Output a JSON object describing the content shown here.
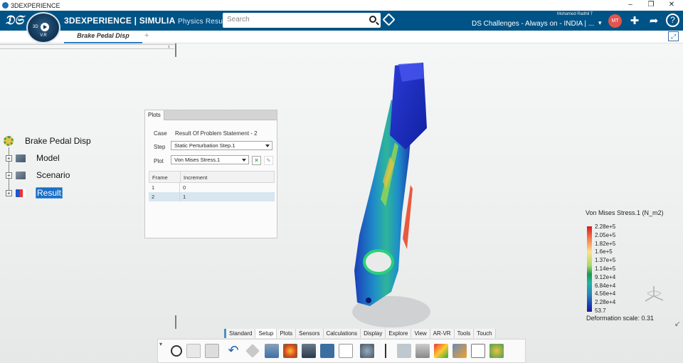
{
  "window": {
    "title": "3DEXPERIENCE",
    "controls": [
      "–",
      "❐",
      "✕"
    ]
  },
  "topbar": {
    "compass_version": "V.R",
    "compass_3d": "3D",
    "brand_prefix": "3D",
    "brand_main": "EXPERIENCE | SIMULIA",
    "brand_app": "Physics Results Explorer",
    "search_placeholder": "Search",
    "user_name": "Mohamed Radhil T",
    "collab_space": "DS Challenges - Always on - INDIA | ...",
    "avatar_initials": "MT",
    "icons": [
      "tag-icon",
      "plus-icon",
      "share-icon",
      "help-icon"
    ]
  },
  "tabs": {
    "active": "Brake Pedal Disp",
    "add": "+"
  },
  "tree": {
    "root": "Brake Pedal Disp",
    "items": [
      {
        "label": "Model",
        "selected": false
      },
      {
        "label": "Scenario",
        "selected": false
      },
      {
        "label": "Result",
        "selected": true
      }
    ]
  },
  "plots_panel": {
    "tab": "Plots",
    "case_label": "Case",
    "case_value": "Result Of Problem Statement - 2",
    "step_label": "Step",
    "step_value": "Static Perturbation Step.1",
    "plot_label": "Plot",
    "plot_value": "Von Mises Stress.1",
    "table": {
      "headers": [
        "Frame",
        "Increment"
      ],
      "rows": [
        {
          "frame": "1",
          "increment": "0",
          "selected": false
        },
        {
          "frame": "2",
          "increment": "1",
          "selected": true
        }
      ]
    }
  },
  "legend": {
    "title": "Von Mises Stress.1 (N_m2)",
    "labels": [
      "2.28e+5",
      "2.05e+5",
      "1.82e+5",
      "1.6e+5",
      "1.37e+5",
      "1.14e+5",
      "9.12e+4",
      "6.84e+4",
      "4.56e+4",
      "2.28e+4",
      "53.7"
    ],
    "deformation": "Deformation scale: 0.31"
  },
  "toolbar": {
    "tabs": [
      "Standard",
      "Setup",
      "Plots",
      "Sensors",
      "Calculations",
      "Display",
      "Explore",
      "View",
      "AR-VR",
      "Tools",
      "Touch"
    ],
    "active_tab": "Setup"
  }
}
